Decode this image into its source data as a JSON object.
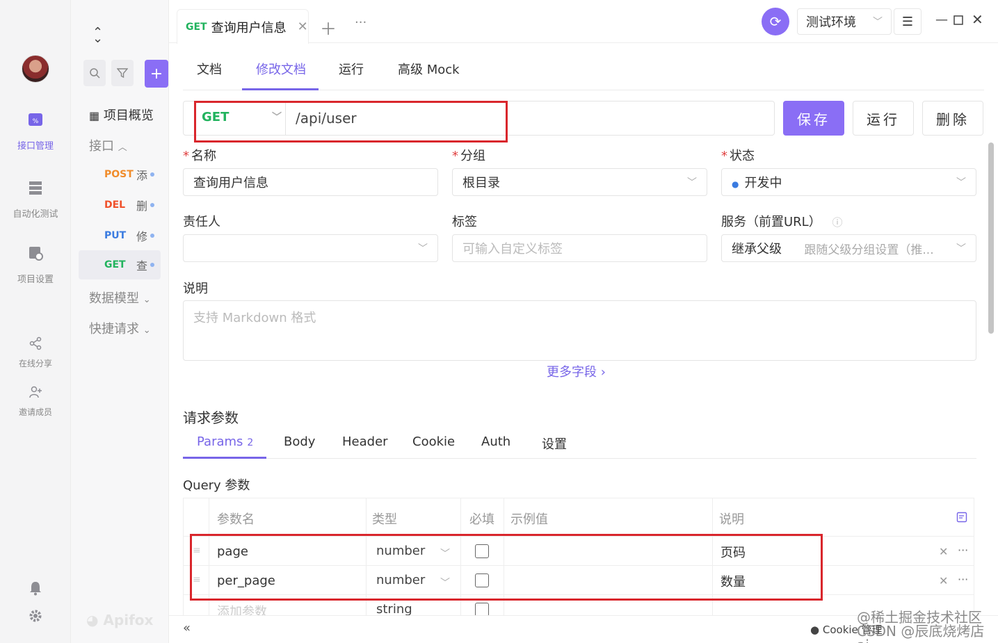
{
  "rail": {
    "items": [
      {
        "label": "接口管理",
        "icon": "api-icon"
      },
      {
        "label": "自动化测试",
        "icon": "automation-icon"
      },
      {
        "label": "项目设置",
        "icon": "settings-doc-icon"
      },
      {
        "label": "在线分享",
        "icon": "share-icon"
      },
      {
        "label": "邀请成员",
        "icon": "invite-icon"
      }
    ]
  },
  "nav": {
    "overview": "项目概览",
    "interfaces": "接口",
    "apis": [
      {
        "method": "POST",
        "name": "添"
      },
      {
        "method": "DEL",
        "name": "删"
      },
      {
        "method": "PUT",
        "name": "修"
      },
      {
        "method": "GET",
        "name": "查"
      }
    ],
    "data_model": "数据模型",
    "quick_request": "快捷请求",
    "brand": "Apifox"
  },
  "topbar": {
    "tab_method": "GET",
    "tab_title": "查询用户信息",
    "env": "测试环境"
  },
  "subtabs": [
    "文档",
    "修改文档",
    "运行",
    "高级 Mock"
  ],
  "request": {
    "method": "GET",
    "url": "/api/user",
    "save": "保存",
    "run": "运行",
    "delete": "删除"
  },
  "form": {
    "name_label": "名称",
    "name_value": "查询用户信息",
    "group_label": "分组",
    "group_value": "根目录",
    "status_label": "状态",
    "status_value": "开发中",
    "owner_label": "责任人",
    "tags_label": "标签",
    "tags_placeholder": "可输入自定义标签",
    "service_label": "服务（前置URL）",
    "service_value": "继承父级",
    "service_hint": "跟随父级分组设置（推...",
    "desc_label": "说明",
    "desc_placeholder": "支持 Markdown 格式",
    "more_fields": "更多字段 ›"
  },
  "params": {
    "section_title": "请求参数",
    "tabs": [
      "Params",
      "Body",
      "Header",
      "Cookie",
      "Auth",
      "设置"
    ],
    "params_count": "2",
    "query_title": "Query 参数",
    "columns": [
      "参数名",
      "类型",
      "必填",
      "示例值",
      "说明"
    ],
    "rows": [
      {
        "name": "page",
        "type": "number",
        "desc": "页码"
      },
      {
        "name": "per_page",
        "type": "number",
        "desc": "数量"
      }
    ],
    "add_row_placeholder": "添加参数",
    "add_row_type": "string"
  },
  "bottom": {
    "cookie": "Cookie 管理",
    "watermark": "@稀土掘金技术社区 CSDN @辰底烧烤店ai"
  }
}
